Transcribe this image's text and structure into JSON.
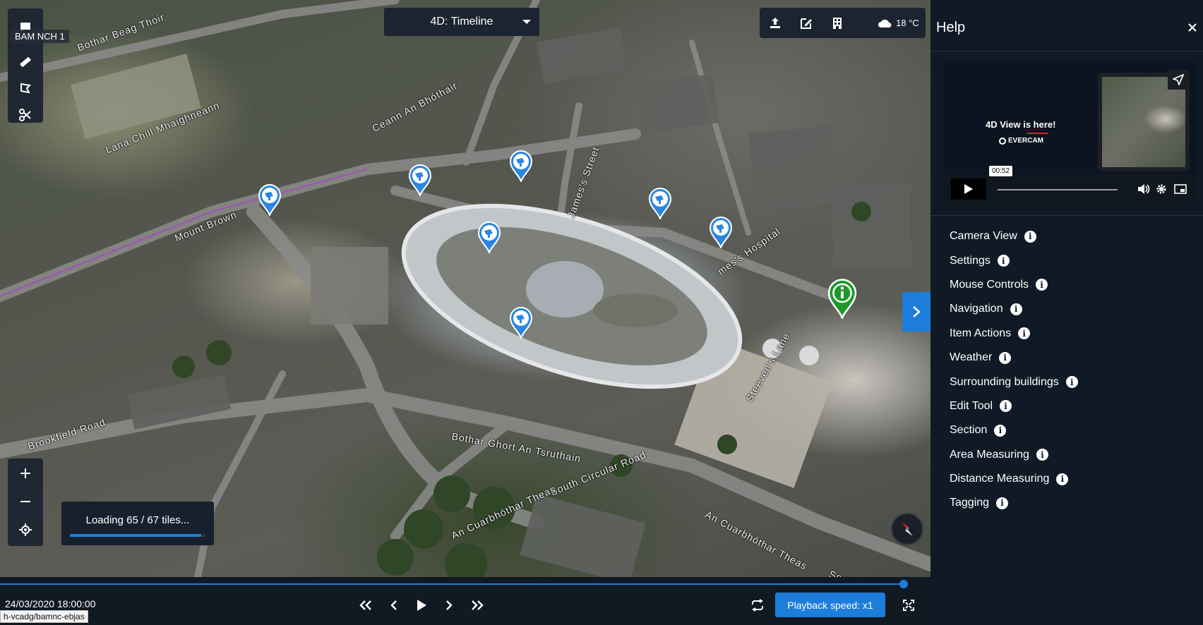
{
  "project_label": "BAM NCH 1",
  "view_mode": {
    "label": "4D: Timeline"
  },
  "weather": {
    "temperature": "18 °C",
    "icon": "cloud-icon"
  },
  "loading": {
    "text": "Loading 65 / 67 tiles...",
    "progress": 0.97
  },
  "timeline": {
    "datetime": "24/03/2020 18:00:00",
    "progress": 1.0,
    "speed_label": "Playback speed: x1"
  },
  "status_url": "h-vcadg/bamnc-ebjas",
  "map_labels": [
    {
      "text": "Bothar Beag Thoir",
      "rot": -20
    },
    {
      "text": "Lana Chill Mhaighneann",
      "rot": -22
    },
    {
      "text": "Mount Brown",
      "rot": -22
    },
    {
      "text": "Ceann An Bhóthair",
      "rot": -28
    },
    {
      "text": "James's Street",
      "rot": -70
    },
    {
      "text": "mes's Hospital",
      "rot": -35
    },
    {
      "text": "Brookfield Road",
      "rot": -18
    },
    {
      "text": "Bothar Ghort An Tsruthain",
      "rot": 10
    },
    {
      "text": "South Circular Road",
      "rot": -22
    },
    {
      "text": "An Cuarbhóthar Theas",
      "rot": -25
    },
    {
      "text": "An Cuarbhóthar Theas",
      "rot": 28
    },
    {
      "text": "Sout",
      "rot": 20
    },
    {
      "text": "Steeven's Lane",
      "rot": -60
    }
  ],
  "help": {
    "title": "Help",
    "video": {
      "title": "4D View is here!",
      "brand": "EVERCAM",
      "time": "00:52"
    },
    "items": [
      {
        "label": "Camera View"
      },
      {
        "label": "Settings"
      },
      {
        "label": "Mouse Controls"
      },
      {
        "label": "Navigation"
      },
      {
        "label": "Item Actions"
      },
      {
        "label": "Weather"
      },
      {
        "label": "Surrounding buildings"
      },
      {
        "label": "Edit Tool"
      },
      {
        "label": "Section"
      },
      {
        "label": "Area Measuring"
      },
      {
        "label": "Distance Measuring"
      },
      {
        "label": "Tagging"
      }
    ]
  },
  "colors": {
    "accent": "#1d7ddb",
    "panel": "#0f1a26",
    "camera_pin": "#2a86e0",
    "info_pin": "#1f9a2a"
  }
}
